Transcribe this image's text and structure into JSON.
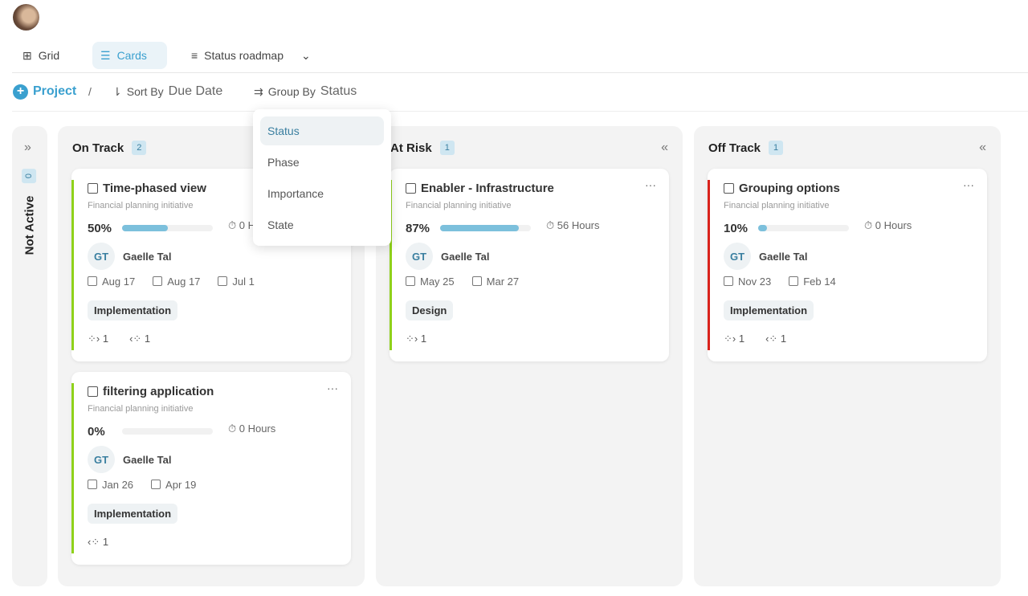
{
  "views": {
    "tabs": [
      {
        "label": "Grid",
        "icon": "grid-icon"
      },
      {
        "label": "Cards",
        "icon": "cards-icon",
        "active": true
      },
      {
        "label": "Status roadmap",
        "icon": "roadmap-icon"
      }
    ]
  },
  "toolbar": {
    "add_label": "Project",
    "sort_label": "Sort By",
    "sort_value": "Due Date",
    "group_label": "Group By",
    "group_value": "Status"
  },
  "group_menu": {
    "options": [
      "Status",
      "Phase",
      "Importance",
      "State"
    ],
    "selected": "Status"
  },
  "colors": {
    "accent": "#3aa0cf",
    "on_track": "#8fd11a",
    "off_track": "#d9231c",
    "progress": "#7cc0dc"
  },
  "columns": [
    {
      "title": "Not Active",
      "count": "0",
      "collapsed": true
    },
    {
      "title": "On Track",
      "count": "2",
      "cards": [
        {
          "title": "Time-phased view",
          "subtitle": "Financial planning initiative",
          "percent": "50%",
          "progress": 50,
          "hours": "0 Hours",
          "assignee_initials": "GT",
          "assignee": "Gaelle Tal",
          "dates": [
            "Aug 17",
            "Aug 17",
            "Jul 1"
          ],
          "phase": "Implementation",
          "deps": [
            "1",
            "1"
          ],
          "status_color": "#8fd11a"
        },
        {
          "title": "filtering application",
          "subtitle": "Financial planning initiative",
          "percent": "0%",
          "progress": 0,
          "hours": "0 Hours",
          "assignee_initials": "GT",
          "assignee": "Gaelle Tal",
          "dates": [
            "Jan 26",
            "Apr 19"
          ],
          "phase": "Implementation",
          "deps": [
            null,
            "1"
          ],
          "status_color": "#8fd11a"
        }
      ]
    },
    {
      "title": "At Risk",
      "count": "1",
      "cards": [
        {
          "title": "Enabler - Infrastructure",
          "subtitle": "Financial planning initiative",
          "percent": "87%",
          "progress": 87,
          "hours": "56 Hours",
          "assignee_initials": "GT",
          "assignee": "Gaelle Tal",
          "dates": [
            "May 25",
            "Mar 27"
          ],
          "phase": "Design",
          "deps": [
            "1",
            null
          ],
          "status_color": "#8fd11a"
        }
      ]
    },
    {
      "title": "Off Track",
      "count": "1",
      "cards": [
        {
          "title": "Grouping options",
          "subtitle": "Financial planning initiative",
          "percent": "10%",
          "progress": 10,
          "hours": "0 Hours",
          "assignee_initials": "GT",
          "assignee": "Gaelle Tal",
          "dates": [
            "Nov 23",
            "Feb 14"
          ],
          "phase": "Implementation",
          "deps": [
            "1",
            "1"
          ],
          "status_color": "#d9231c"
        }
      ]
    }
  ]
}
